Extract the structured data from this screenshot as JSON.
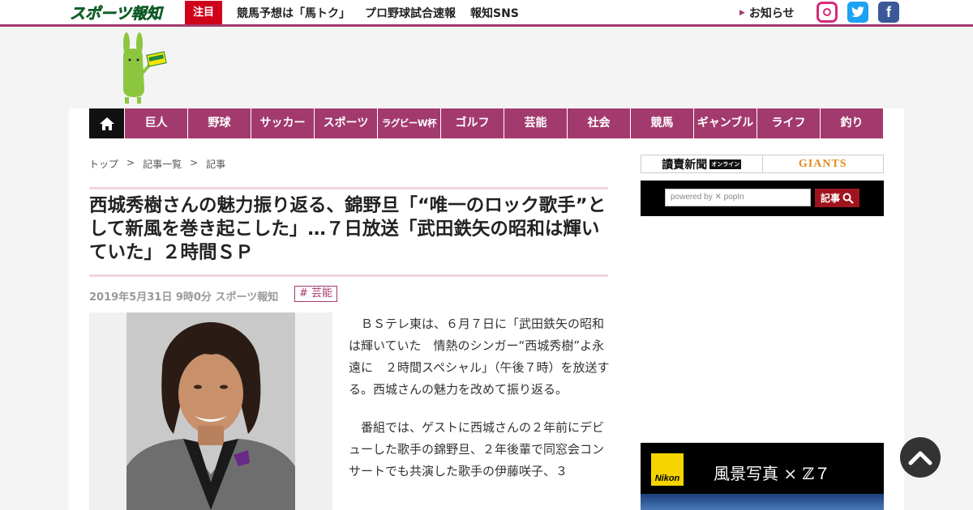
{
  "header": {
    "logo_text": "スポーツ報知",
    "chumoku_label": "注目",
    "nav": [
      "競馬予想は「馬トク」",
      "プロ野球試合速報",
      "報知SNS"
    ],
    "oshirase_label": "お知らせ",
    "social": [
      "instagram-icon",
      "twitter-icon",
      "facebook-icon"
    ]
  },
  "categories": [
    "巨人",
    "野球",
    "サッカー",
    "スポーツ",
    "ラグビーW杯",
    "ゴルフ",
    "芸能",
    "社会",
    "競馬",
    "ギャンブル",
    "ライフ",
    "釣り"
  ],
  "breadcrumb": [
    "トップ",
    ">",
    "記事一覧",
    ">",
    "記事"
  ],
  "article": {
    "headline": "西城秀樹さんの魅力振り返る、錦野旦「“唯一のロック歌手”として新風を巻き起こした」…７日放送「武田鉄矢の昭和は輝いていた」２時間ＳＰ",
    "meta": "2019年5月31日 9時0分  スポーツ報知",
    "tag": "# 芸能",
    "paragraphs": [
      "ＢＳテレ東は、６月７日に「武田鉄矢の昭和は輝いていた　情熱のシンガー“西城秀樹”よ永遠に　２時間スペシャル」（午後７時）を放送する。西城さんの魅力を改めて振り返る。",
      "番組では、ゲストに西城さんの２年前にデビューした歌手の錦野旦、２年後輩で同窓会コンサートでも共演した歌手の伊藤咲子、３"
    ]
  },
  "sidebar": {
    "yomiuri_label": "讀賣新聞",
    "yomiuri_online": "オンライン",
    "giants_label": "GIANTS",
    "search_placeholder": "powered by ✕ popIn",
    "search_button": "記事"
  },
  "ad": {
    "brand": "Nikon",
    "text": "風景写真 × ℤ７"
  },
  "colors": {
    "accent": "#a33a6e",
    "chumoku": "#d0021b",
    "search_button": "#a0141e",
    "twitter": "#1da1f2",
    "facebook": "#3b5998"
  }
}
